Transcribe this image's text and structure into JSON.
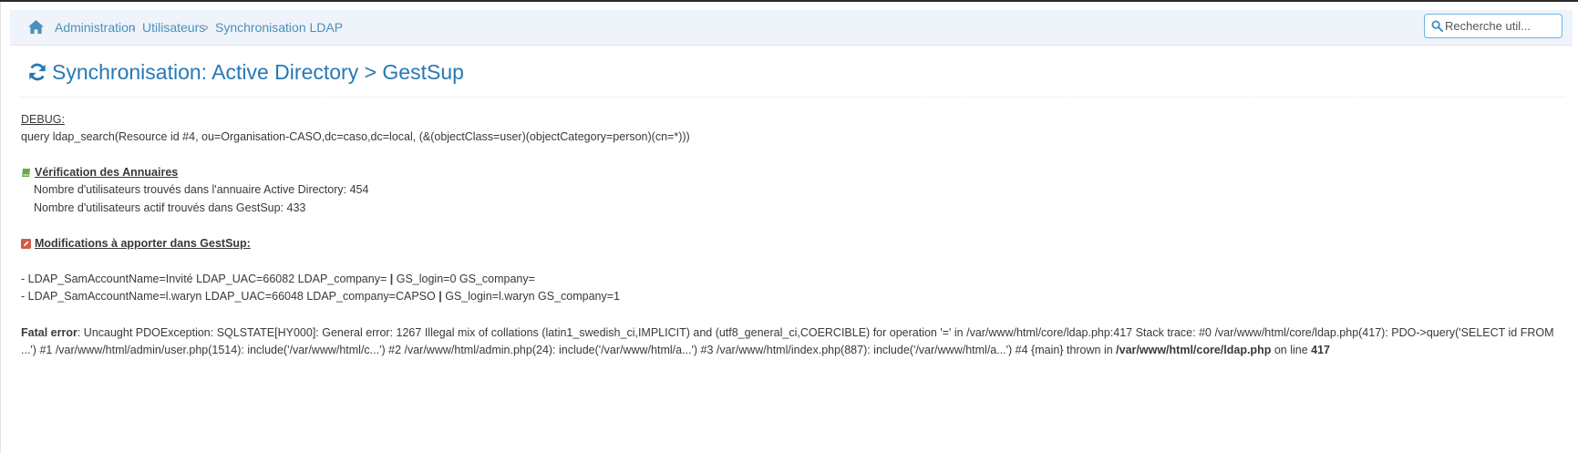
{
  "breadcrumbs": {
    "items": [
      "Administration",
      "Utilisateurs",
      "Synchronisation LDAP"
    ],
    "separator": "›"
  },
  "search": {
    "placeholder": "Recherche util..."
  },
  "page": {
    "title": "Synchronisation: Active Directory > GestSup"
  },
  "debug": {
    "label": "DEBUG:",
    "query": "query ldap_search(Resource id #4, ou=Organisation-CASO,dc=caso,dc=local, (&(objectClass=user)(objectCategory=person)(cn=*)))"
  },
  "verification": {
    "heading": "Vérification des Annuaires",
    "ad_count": "Nombre d'utilisateurs trouvés dans l'annuaire Active Directory: 454",
    "gs_count": "Nombre d'utilisateurs actif trouvés dans GestSup: 433"
  },
  "modifications": {
    "heading": "Modifications à apporter dans GestSup:",
    "rows": [
      {
        "left": "- LDAP_SamAccountName=Invité LDAP_UAC=66082 LDAP_company=",
        "sep": "|",
        "right": "GS_login=0 GS_company="
      },
      {
        "left": "- LDAP_SamAccountName=l.waryn LDAP_UAC=66048 LDAP_company=CAPSO",
        "sep": "|",
        "right": "GS_login=l.waryn GS_company=1"
      }
    ]
  },
  "error": {
    "label": "Fatal error",
    "message": ": Uncaught PDOException: SQLSTATE[HY000]: General error: 1267 Illegal mix of collations (latin1_swedish_ci,IMPLICIT) and (utf8_general_ci,COERCIBLE) for operation '=' in /var/www/html/core/ldap.php:417 Stack trace: #0 /var/www/html/core/ldap.php(417): PDO->query('SELECT id FROM ...') #1 /var/www/html/admin/user.php(1514): include('/var/www/html/c...') #2 /var/www/html/admin.php(24): include('/var/www/html/a...') #3 /var/www/html/index.php(887): include('/var/www/html/a...') #4 {main} thrown in ",
    "file": "/var/www/html/core/ldap.php",
    "on_line": " on line ",
    "line": "417"
  },
  "colors": {
    "link": "#4c8fbd",
    "title": "#2679b5",
    "breadcrumb_bg": "#eef4f9",
    "book_icon": "#69aa46",
    "edit_icon": "#d15b47"
  },
  "icons": {
    "home": "home-icon",
    "search": "search-icon",
    "refresh": "refresh-icon",
    "book": "book-icon",
    "edit": "edit-icon"
  }
}
